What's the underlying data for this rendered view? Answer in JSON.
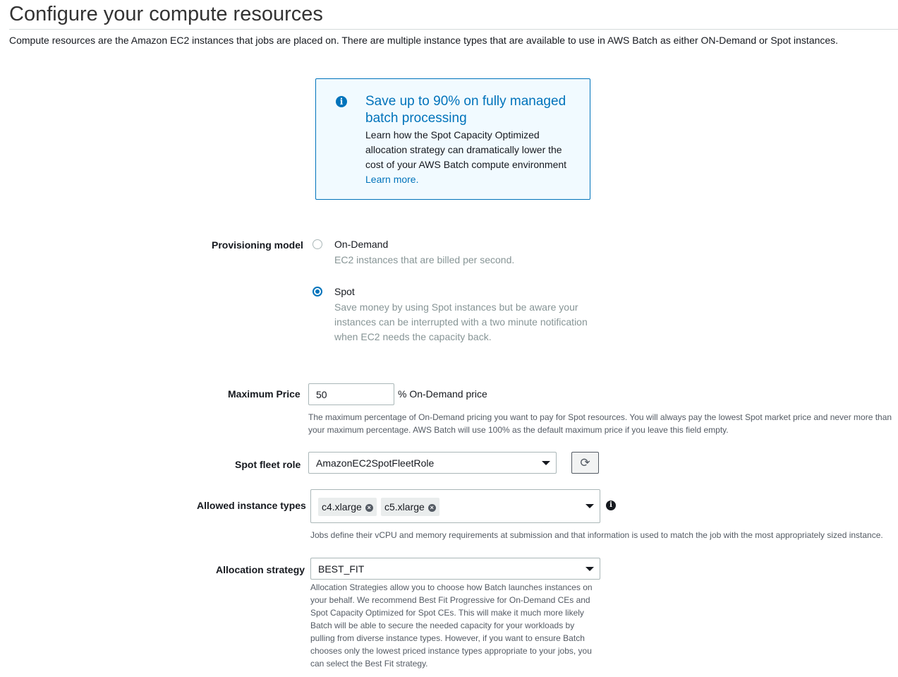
{
  "header": {
    "title": "Configure your compute resources",
    "intro": "Compute resources are the Amazon EC2 instances that jobs are placed on. There are multiple instance types that are available to use in AWS Batch as either ON-Demand or Spot instances."
  },
  "info_box": {
    "icon": "info-circle-icon",
    "title": "Save up to 90% on fully managed batch processing",
    "body": "Learn how the Spot Capacity Optimized allocation strategy can dramatically lower the cost of your AWS Batch compute environment",
    "link": "Learn more."
  },
  "provisioning": {
    "label": "Provisioning model",
    "options": [
      {
        "title": "On-Demand",
        "description": "EC2 instances that are billed per second.",
        "selected": false
      },
      {
        "title": "Spot",
        "description": "Save money by using Spot instances but be aware your instances can be interrupted with a two minute notification when EC2 needs the capacity back.",
        "selected": true
      }
    ]
  },
  "max_price": {
    "label": "Maximum Price",
    "value": "50",
    "suffix": "% On-Demand price",
    "help": "The maximum percentage of On-Demand pricing you want to pay for Spot resources. You will always pay the lowest Spot market price and never more than your maximum percentage. AWS Batch will use 100% as the default maximum price if you leave this field empty."
  },
  "spot_fleet_role": {
    "label": "Spot fleet role",
    "value": "AmazonEC2SpotFleetRole",
    "refresh_icon": "refresh-icon"
  },
  "instance_types": {
    "label": "Allowed instance types",
    "tokens": [
      "c4.xlarge",
      "c5.xlarge"
    ],
    "help": "Jobs define their vCPU and memory requirements at submission and that information is used to match the job with the most appropriately sized instance."
  },
  "allocation": {
    "label": "Allocation strategy",
    "value": "BEST_FIT",
    "help": "Allocation Strategies allow you to choose how Batch launches instances on your behalf. We recommend Best Fit Progressive for On-Demand CEs and Spot Capacity Optimized for Spot CEs. This will make it much more likely Batch will be able to secure the needed capacity for your workloads by pulling from diverse instance types. However, if you want to ensure Batch chooses only the lowest priced instance types appropriate to your jobs, you can select the Best Fit strategy."
  },
  "colors": {
    "accent": "#0073bb",
    "info_bg": "#f1faff",
    "muted_text": "#879596"
  }
}
